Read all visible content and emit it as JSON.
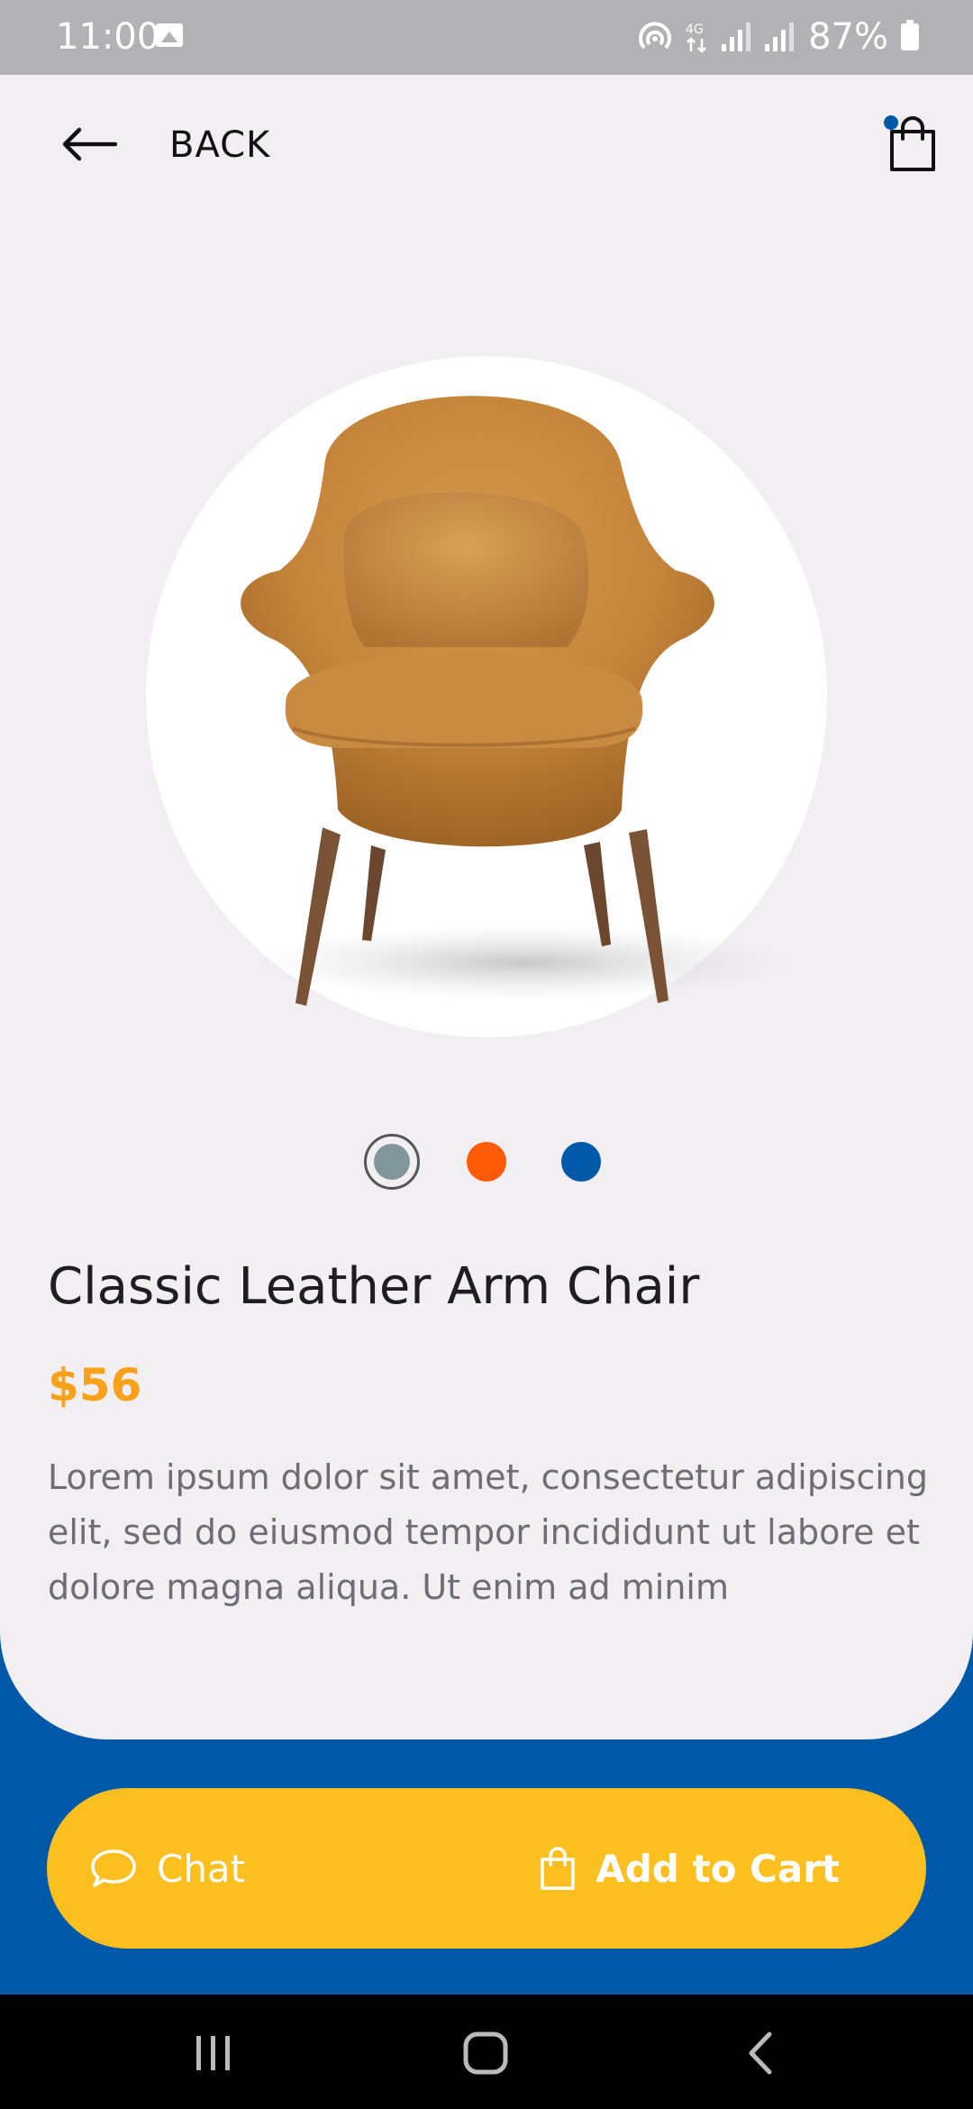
{
  "status_bar": {
    "time": "11:00",
    "network": "4G",
    "battery": "87%"
  },
  "header": {
    "back_label": "BACK",
    "back_icon": "arrow-left-icon",
    "cart_icon": "shopping-bag-icon",
    "cart_has_badge": true
  },
  "product": {
    "image_icon": "armchair-image",
    "title": "Classic Leather Arm Chair",
    "price": "$56",
    "description": "Lorem ipsum dolor sit amet, consectetur adipiscing elit, sed do eiusmod tempor incididunt ut labore et dolore magna aliqua. Ut enim ad minim",
    "colors": [
      {
        "name": "gray",
        "hex": "#81969B",
        "selected": true
      },
      {
        "name": "orange",
        "hex": "#FF5A06",
        "selected": false
      },
      {
        "name": "blue",
        "hex": "#0059A8",
        "selected": false
      }
    ]
  },
  "actions": {
    "chat_label": "Chat",
    "chat_icon": "chat-bubble-icon",
    "add_to_cart_label": "Add to Cart",
    "add_to_cart_icon": "shopping-bag-icon"
  },
  "theme": {
    "primary": "#0059A8",
    "accent": "#FBC020",
    "price": "#F9A11B",
    "background": "#F1EFF2"
  },
  "nav_bar": {
    "recent_icon": "recent-apps-icon",
    "home_icon": "home-icon",
    "back_icon": "back-icon"
  }
}
